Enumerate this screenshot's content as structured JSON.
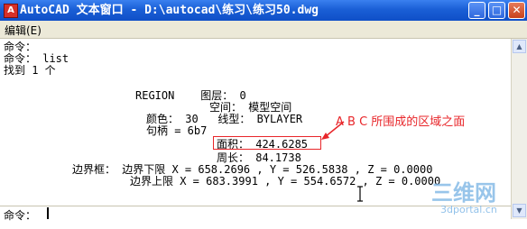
{
  "window": {
    "title": "AutoCAD 文本窗口 - D:\\autocad\\练习\\练习50.dwg",
    "app_icon": "autocad-icon",
    "buttons": {
      "minimize": "_",
      "maximize": "□",
      "close": "✕"
    }
  },
  "menu": {
    "edit": "编辑(E)"
  },
  "text_lines": [
    "命令：",
    "命令： list",
    "找到 1 个",
    "REGION    图层： 0",
    "空间： 模型空间",
    "颜色： 30   线型： BYLAYER",
    "句柄 = 6b7",
    "面积： 424.6285",
    "周长： 84.1738",
    "边界框： 边界下限 X = 658.2696 , Y = 526.5838 , Z = 0.0000",
    "边界上限 X = 683.3991 , Y = 554.6572 , Z = 0.0000"
  ],
  "annotation": {
    "text": "A B C 所围成的区域之面",
    "color": "#e8262a"
  },
  "prompt": {
    "label": "命令："
  },
  "watermark": {
    "main": "三维网",
    "sub": "3dportal.cn"
  },
  "colors": {
    "title_bar": "#1a5fd6",
    "highlight": "#e8262a",
    "menu_bg": "#ece9d8"
  }
}
